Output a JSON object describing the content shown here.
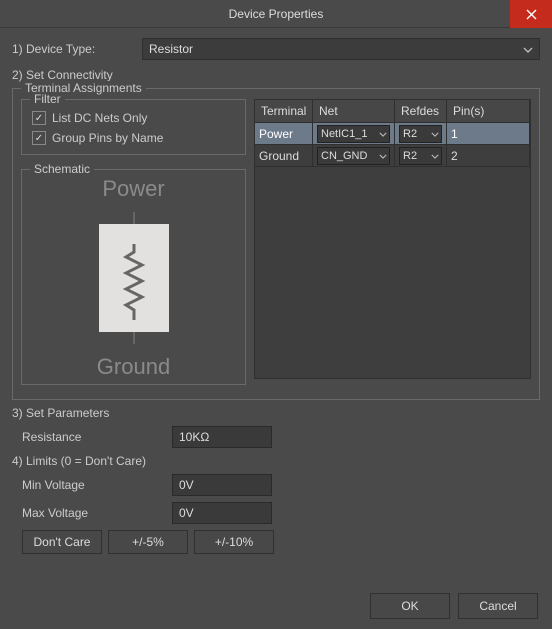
{
  "window": {
    "title": "Device Properties"
  },
  "steps": {
    "s1": "1) Device Type:",
    "s2": "2) Set Connectivity",
    "s3": "3) Set Parameters",
    "s4": "4) Limits (0 = Don't Care)"
  },
  "device_type": {
    "value": "Resistor"
  },
  "terminal_group_title": "Terminal Assignments",
  "filter": {
    "title": "Filter",
    "list_dc": {
      "label": "List DC Nets Only",
      "checked": true
    },
    "group_pins": {
      "label": "Group Pins by Name",
      "checked": true
    }
  },
  "schematic": {
    "title": "Schematic",
    "top_label": "Power",
    "bottom_label": "Ground"
  },
  "table": {
    "headers": {
      "terminal": "Terminal",
      "net": "Net",
      "refdes": "Refdes",
      "pins": "Pin(s)"
    },
    "rows": [
      {
        "terminal": "Power",
        "net": "NetIC1_1",
        "refdes": "R2",
        "pins": "1",
        "selected": true
      },
      {
        "terminal": "Ground",
        "net": "CN_GND",
        "refdes": "R2",
        "pins": "2",
        "selected": false
      }
    ]
  },
  "params": {
    "resistance": {
      "label": "Resistance",
      "value": "10KΩ"
    }
  },
  "limits": {
    "min_voltage": {
      "label": "Min Voltage",
      "value": "0V"
    },
    "max_voltage": {
      "label": "Max Voltage",
      "value": "0V"
    },
    "buttons": {
      "dont_care": "Don't Care",
      "pm5": "+/-5%",
      "pm10": "+/-10%"
    }
  },
  "footer": {
    "ok": "OK",
    "cancel": "Cancel"
  }
}
